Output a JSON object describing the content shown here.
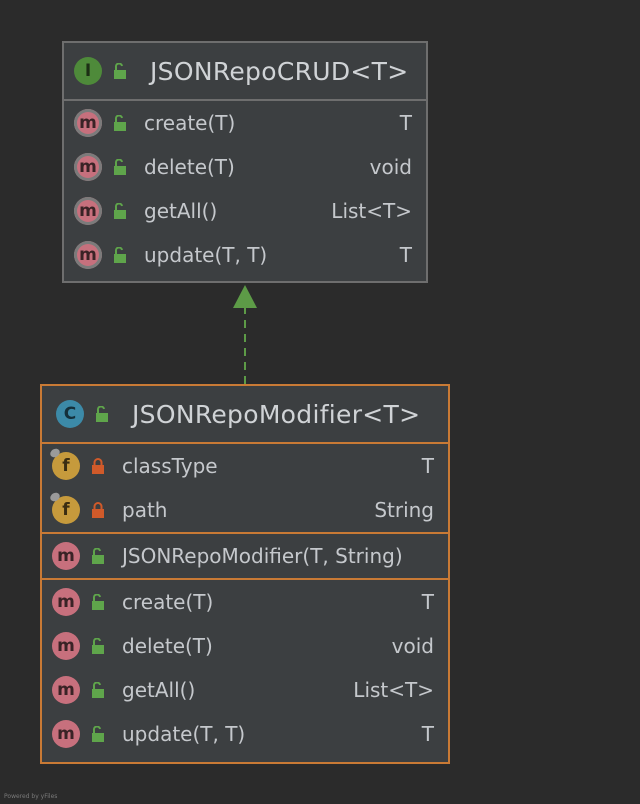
{
  "interface": {
    "badge": "I",
    "title": "JSONRepoCRUD<T>",
    "methods": [
      {
        "badge": "m",
        "name": "create(T)",
        "type": "T"
      },
      {
        "badge": "m",
        "name": "delete(T)",
        "type": "void"
      },
      {
        "badge": "m",
        "name": "getAll()",
        "type": "List<T>"
      },
      {
        "badge": "m",
        "name": "update(T, T)",
        "type": "T"
      }
    ]
  },
  "class": {
    "badge": "C",
    "title": "JSONRepoModifier<T>",
    "fields": [
      {
        "badge": "f",
        "name": "classType",
        "type": "T"
      },
      {
        "badge": "f",
        "name": "path",
        "type": "String"
      }
    ],
    "constructors": [
      {
        "badge": "m",
        "name": "JSONRepoModifier(T, String)",
        "type": ""
      }
    ],
    "methods": [
      {
        "badge": "m",
        "name": "create(T)",
        "type": "T"
      },
      {
        "badge": "m",
        "name": "delete(T)",
        "type": "void"
      },
      {
        "badge": "m",
        "name": "getAll()",
        "type": "List<T>"
      },
      {
        "badge": "m",
        "name": "update(T, T)",
        "type": "T"
      }
    ]
  },
  "footer": "Powered by yFiles",
  "colors": {
    "background": "#2b2b2b",
    "interface_border": "#6e6e6e",
    "class_border": "#c97a35",
    "arrow": "#5d9b47",
    "public_lock": "#5fa54b",
    "private_lock": "#d05a2a"
  }
}
